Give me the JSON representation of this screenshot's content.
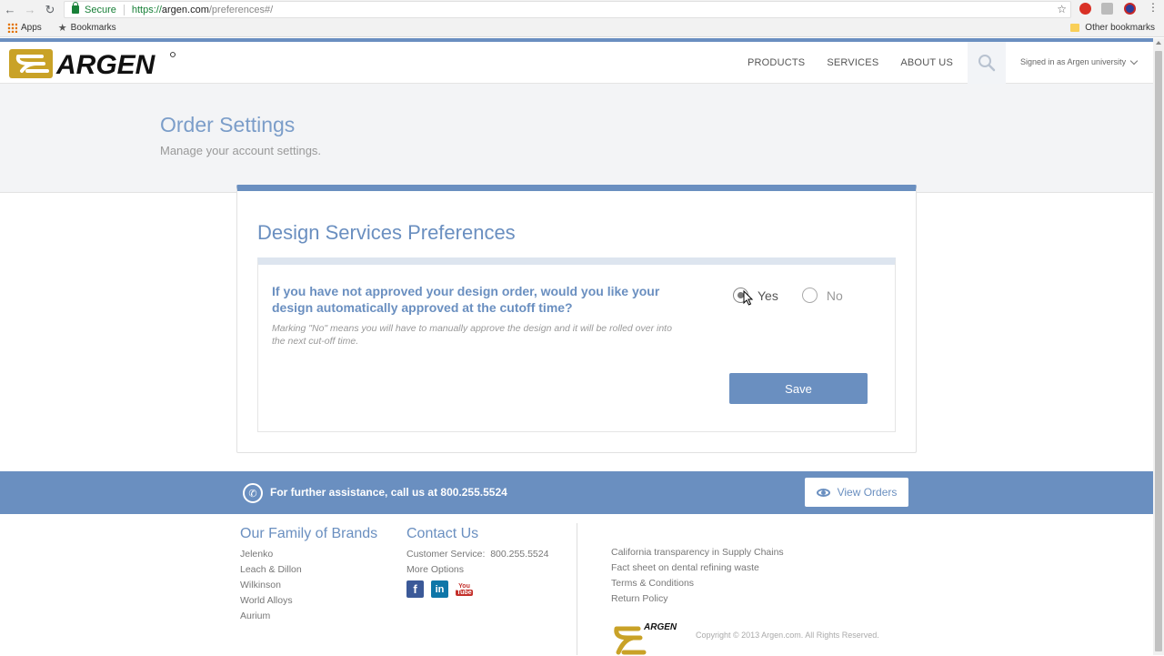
{
  "browser": {
    "secure_label": "Secure",
    "url_scheme": "https://",
    "url_host": "argen.com",
    "url_path": "/preferences#/",
    "bookmarks": {
      "apps": "Apps",
      "bookmarks": "Bookmarks",
      "other": "Other bookmarks"
    }
  },
  "header": {
    "logo_text": "ARGEN",
    "nav": [
      "PRODUCTS",
      "SERVICES",
      "ABOUT US"
    ],
    "signed_in": "Signed in as Argen university"
  },
  "hero": {
    "title": "Order Settings",
    "subtitle": "Manage your account settings."
  },
  "card": {
    "title": "Design Services Preferences",
    "question": "If you have not approved your design order, would you like your design automatically approved at the cutoff time?",
    "note": "Marking \"No\" means you will have to manually approve the design and it will be rolled over into the next cut-off time.",
    "options": [
      {
        "label": "Yes",
        "checked": true
      },
      {
        "label": "No",
        "checked": false
      }
    ],
    "save_label": "Save"
  },
  "assist": {
    "text": "For further assistance, call us at 800.255.5524",
    "view_orders": "View Orders"
  },
  "footer": {
    "brands_heading": "Our Family of Brands",
    "brands": [
      "Jelenko",
      "Leach & Dillon",
      "Wilkinson",
      "World Alloys",
      "Aurium"
    ],
    "contact_heading": "Contact Us",
    "customer_service": "Customer Service:  800.255.5524",
    "more_options": "More Options",
    "socials": {
      "youtube_top": "You",
      "youtube_bottom": "Tube"
    },
    "legal": [
      "California transparency in Supply Chains",
      "Fact sheet on dental refining waste",
      "Terms & Conditions",
      "Return Policy"
    ],
    "copyright": "Copyright © 2013 Argen.com. All Rights Reserved."
  },
  "colors": {
    "accent": "#6a8fc0",
    "gold": "#c9a227"
  }
}
